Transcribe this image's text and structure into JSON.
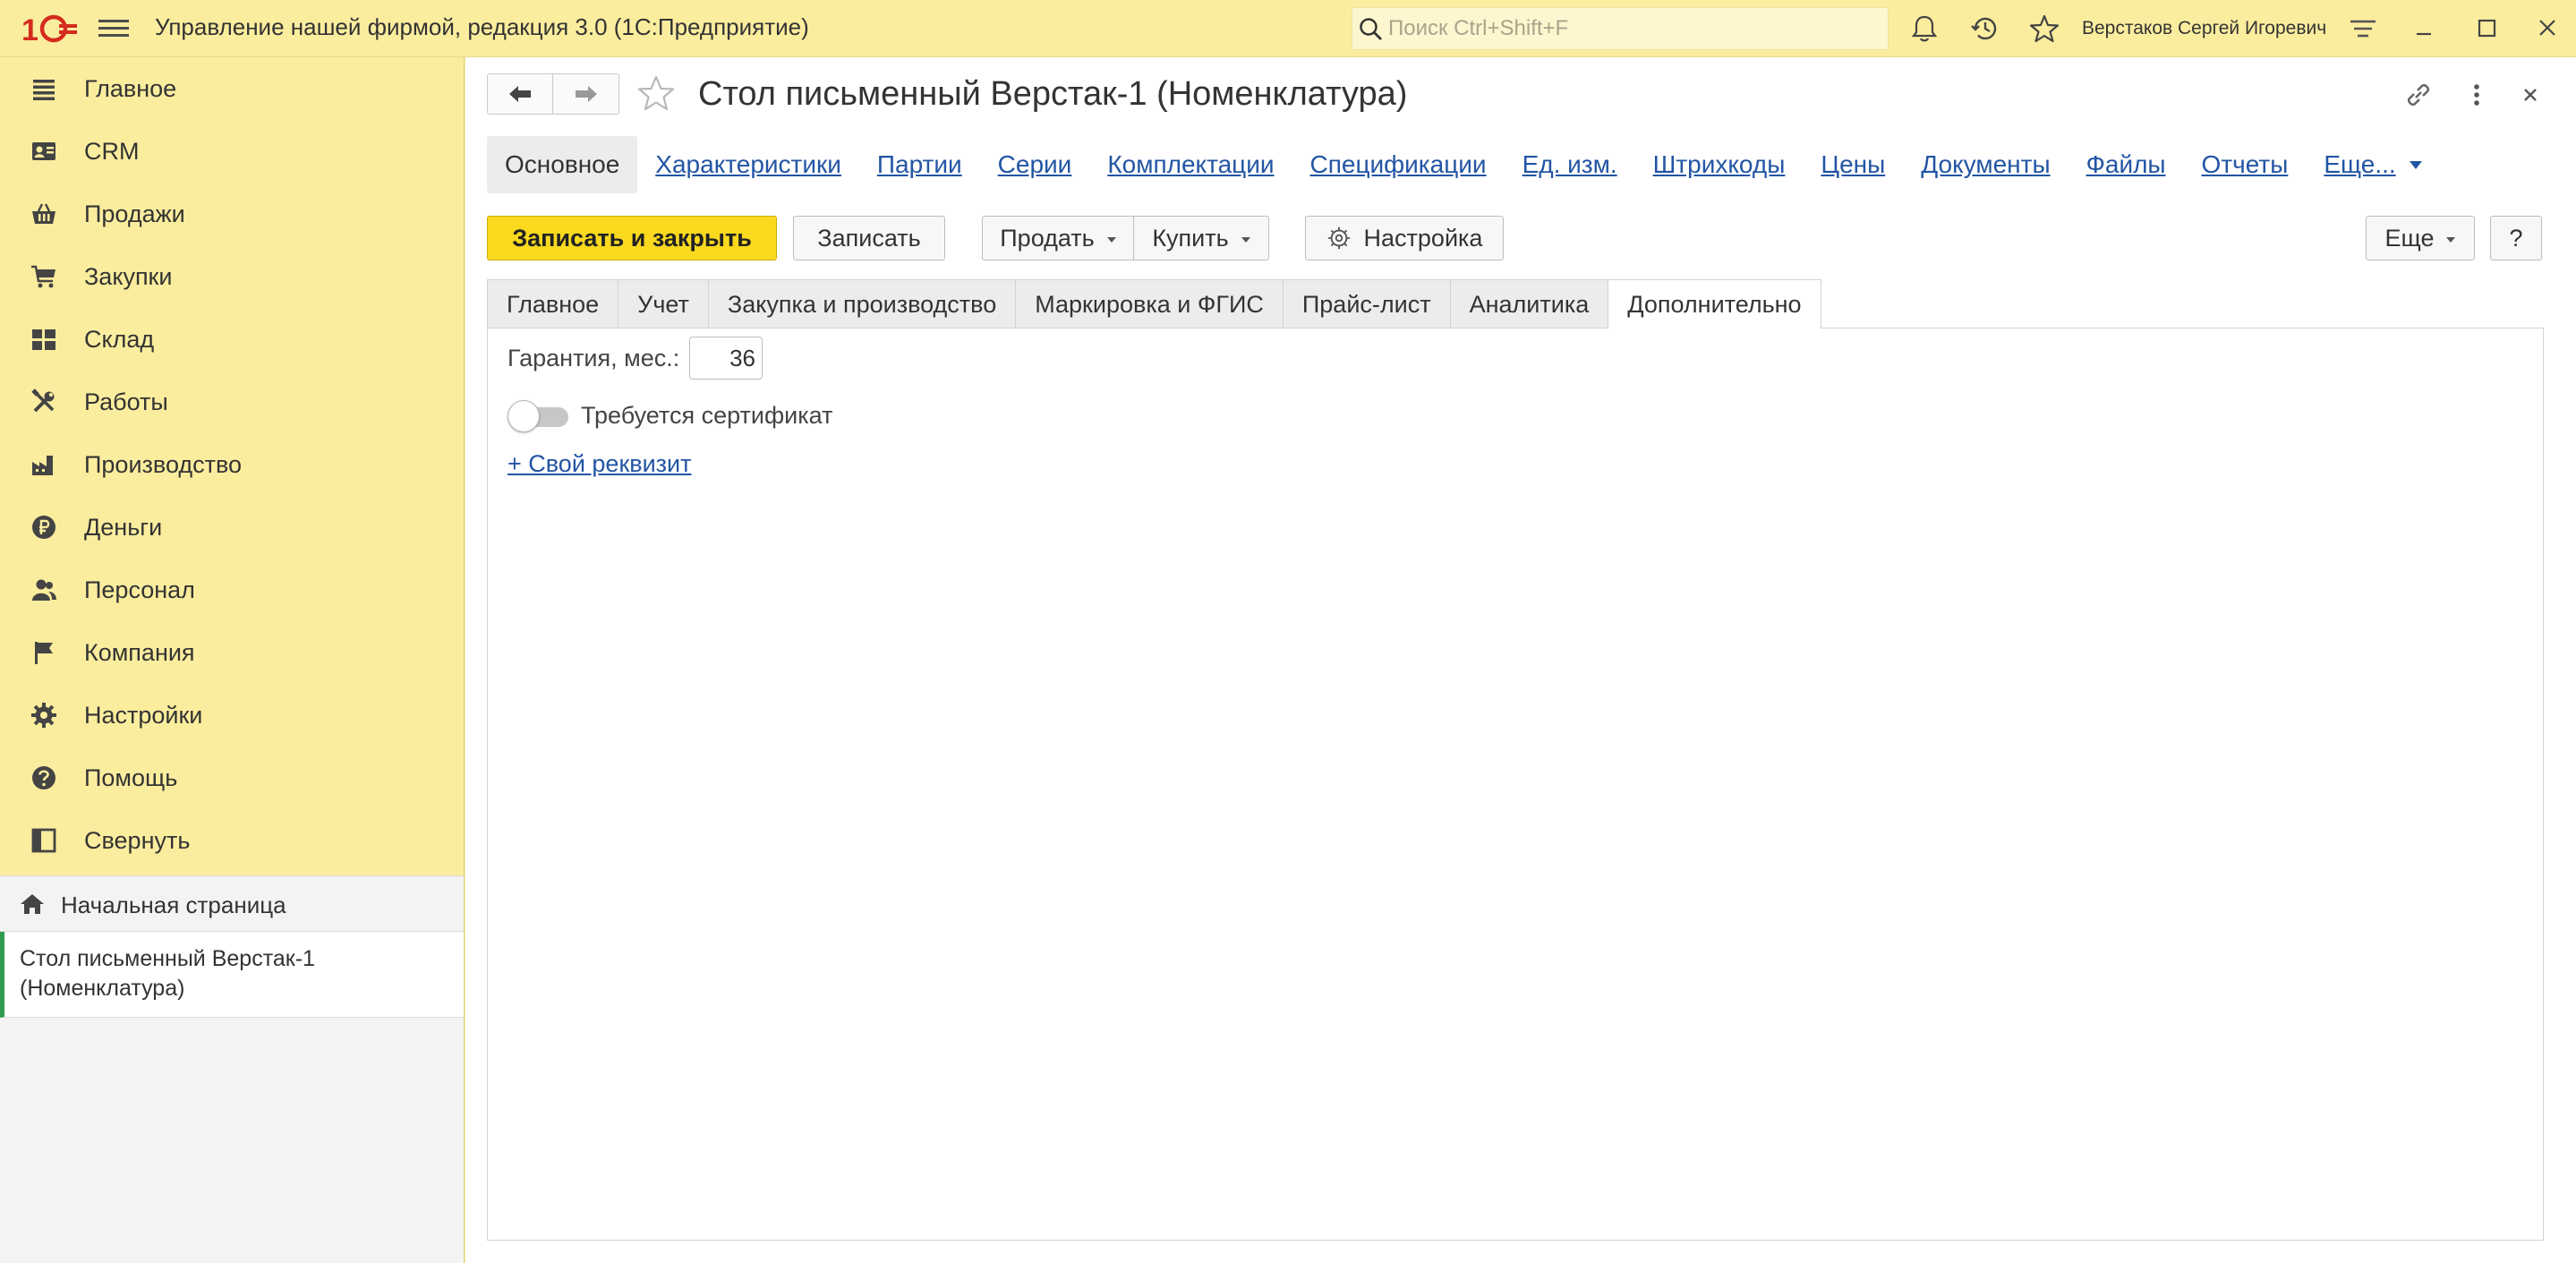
{
  "app": {
    "title": "Управление нашей фирмой, редакция 3.0  (1С:Предприятие)",
    "logo_icon": "1c-logo-icon",
    "accent_color": "#fbed9e",
    "primary_button_color": "#fad91e",
    "link_color": "#2255a4"
  },
  "search": {
    "placeholder": "Поиск Ctrl+Shift+F",
    "value": ""
  },
  "user": {
    "name": "Верстаков Сергей Игоревич"
  },
  "sidebar": {
    "items": [
      {
        "label": "Главное",
        "icon": "list-icon"
      },
      {
        "label": "CRM",
        "icon": "contact-card-icon"
      },
      {
        "label": "Продажи",
        "icon": "basket-icon"
      },
      {
        "label": "Закупки",
        "icon": "cart-icon"
      },
      {
        "label": "Склад",
        "icon": "warehouse-grid-icon"
      },
      {
        "label": "Работы",
        "icon": "tools-icon"
      },
      {
        "label": "Производство",
        "icon": "factory-icon"
      },
      {
        "label": "Деньги",
        "icon": "ruble-coin-icon"
      },
      {
        "label": "Персонал",
        "icon": "people-icon"
      },
      {
        "label": "Компания",
        "icon": "flag-icon"
      },
      {
        "label": "Настройки",
        "icon": "gear-icon"
      },
      {
        "label": "Помощь",
        "icon": "question-circle-icon"
      },
      {
        "label": "Свернуть",
        "icon": "collapse-panel-icon"
      }
    ],
    "open_pages": {
      "home": "Начальная страница",
      "current_page": "Стол письменный Верстак-1 (Номенклатура)"
    }
  },
  "form": {
    "title": "Стол письменный Верстак-1 (Номенклатура)",
    "section_links": {
      "active": "Основное",
      "links": [
        "Характеристики",
        "Партии",
        "Серии",
        "Комплектации",
        "Спецификации",
        "Ед. изм.",
        "Штрихкоды",
        "Цены",
        "Документы",
        "Файлы",
        "Отчеты"
      ],
      "more": "Еще..."
    },
    "commands": {
      "save_close": "Записать и закрыть",
      "save": "Записать",
      "sell": "Продать",
      "buy": "Купить",
      "settings": "Настройка",
      "more": "Еще",
      "help": "?"
    },
    "tabs": [
      "Главное",
      "Учет",
      "Закупка и производство",
      "Маркировка и ФГИС",
      "Прайс-лист",
      "Аналитика",
      "Дополнительно"
    ],
    "active_tab": "Дополнительно",
    "fields": {
      "warranty_label": "Гарантия, мес.:",
      "warranty_value": "36",
      "certificate_label": "Требуется сертификат",
      "certificate_required": false,
      "add_attribute": "+ Свой реквизит"
    }
  }
}
